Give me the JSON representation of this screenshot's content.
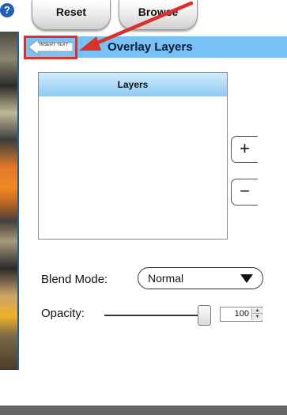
{
  "toolbar": {
    "reset_label": "Reset",
    "browse_label": "Browse"
  },
  "header": {
    "title": "Overlay Layers",
    "insert_text_label": "INSERT TEXT",
    "help_icon": "?"
  },
  "layers_panel": {
    "header": "Layers",
    "items": [],
    "add_label": "+",
    "remove_label": "−"
  },
  "blend": {
    "label": "Blend Mode:",
    "selected": "Normal"
  },
  "opacity": {
    "label": "Opacity:",
    "value": "100",
    "level_percent": 100
  },
  "colors": {
    "header_bar": "#78c1f4",
    "highlight": "#d9312b",
    "annotation_arrow": "#d9312b"
  },
  "icons": {
    "help": "question-circle-icon",
    "insert": "left-arrow-icon",
    "annotation": "red-arrow-icon",
    "caret": "caret-down-icon"
  }
}
